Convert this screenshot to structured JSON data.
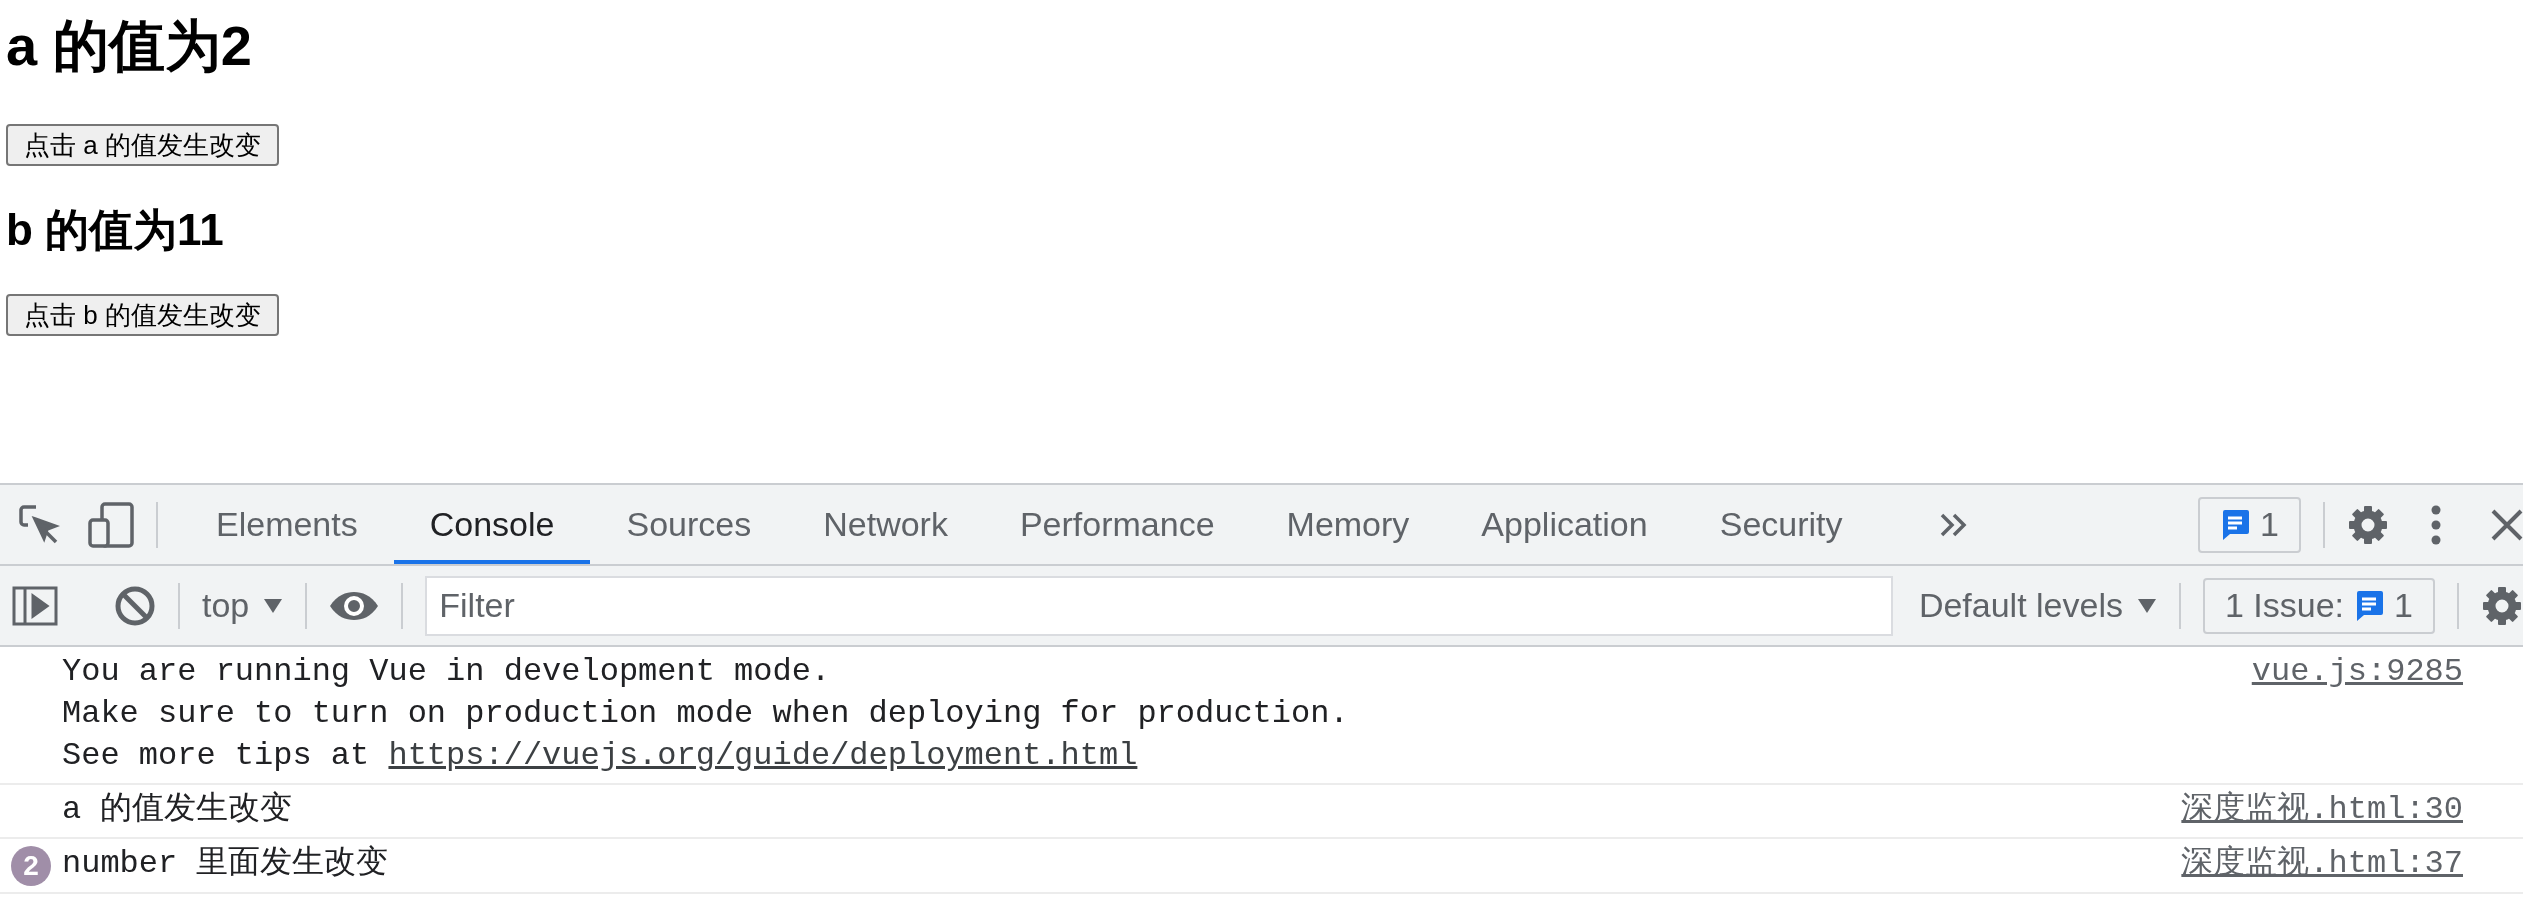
{
  "page": {
    "sections": [
      {
        "kind": "title",
        "heading": "a 的值为2",
        "button": "点击 a 的值发生改变"
      },
      {
        "kind": "subtitle",
        "heading": "b 的值为11",
        "button": "点击 b 的值发生改变"
      }
    ]
  },
  "devtools": {
    "tabs": [
      {
        "label": "Elements",
        "selected": false
      },
      {
        "label": "Console",
        "selected": true
      },
      {
        "label": "Sources",
        "selected": false
      },
      {
        "label": "Network",
        "selected": false
      },
      {
        "label": "Performance",
        "selected": false
      },
      {
        "label": "Memory",
        "selected": false
      },
      {
        "label": "Application",
        "selected": false
      },
      {
        "label": "Security",
        "selected": false
      }
    ],
    "message_count": "1",
    "toolbar": {
      "context": "top",
      "filter_placeholder": "Filter",
      "levels": "Default levels",
      "issues_label": "1 Issue:",
      "issues_count": "1"
    },
    "messages": [
      {
        "lines": [
          "You are running Vue in development mode.",
          "Make sure to turn on production mode when deploying for production."
        ],
        "tip": "See more tips at",
        "link": "https://vuejs.org/guide/deployment.html",
        "source": "vue.js:9285"
      },
      {
        "lines": [
          "a 的值发生改变"
        ],
        "source": "深度监视.html:30"
      },
      {
        "repeat": "2",
        "lines": [
          "number 里面发生改变"
        ],
        "source": "深度监视.html:37"
      }
    ]
  }
}
